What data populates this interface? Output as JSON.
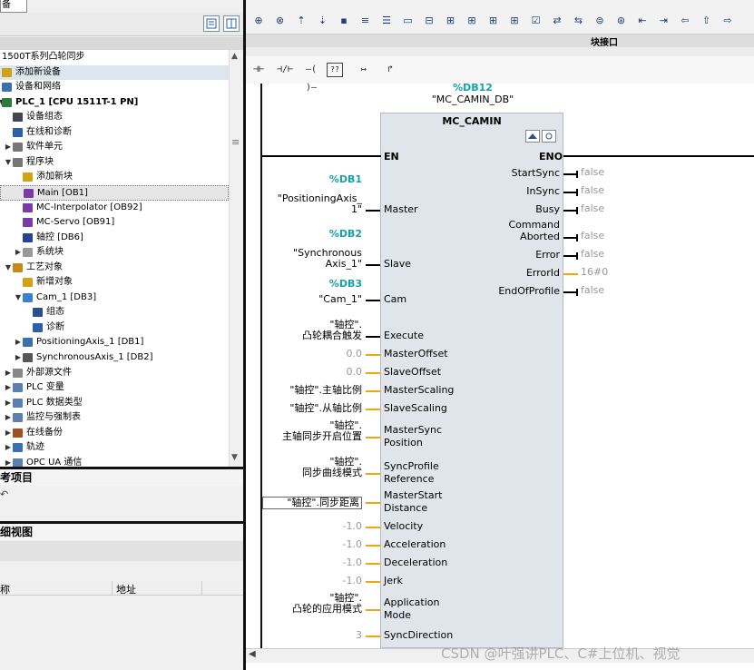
{
  "left_panel": {
    "tab_label": "备",
    "tree": [
      {
        "label": "1500T系列凸轮同步",
        "indent": 0,
        "icon": "none",
        "expander": "none"
      },
      {
        "label": "添加新设备",
        "indent": 0,
        "icon": "add-device-icon",
        "expander": "none",
        "highlight": true
      },
      {
        "label": "设备和网络",
        "indent": 0,
        "icon": "network-icon",
        "expander": "none"
      },
      {
        "label": "PLC_1 [CPU 1511T-1 PN]",
        "indent": 0,
        "icon": "plc-icon",
        "expander": "open",
        "bold": true
      },
      {
        "label": "设备组态",
        "indent": 1,
        "icon": "device-config-icon",
        "expander": "none"
      },
      {
        "label": "在线和诊断",
        "indent": 1,
        "icon": "diagnostics-icon",
        "expander": "none"
      },
      {
        "label": "软件单元",
        "indent": 1,
        "icon": "software-unit-icon",
        "expander": "closed"
      },
      {
        "label": "程序块",
        "indent": 1,
        "icon": "program-blocks-icon",
        "expander": "open"
      },
      {
        "label": "添加新块",
        "indent": 2,
        "icon": "add-block-icon",
        "expander": "none"
      },
      {
        "label": "Main [OB1]",
        "indent": 2,
        "icon": "ob-icon",
        "expander": "none",
        "selected": true
      },
      {
        "label": "MC-Interpolator [OB92]",
        "indent": 2,
        "icon": "ob-icon",
        "expander": "none"
      },
      {
        "label": "MC-Servo [OB91]",
        "indent": 2,
        "icon": "ob-icon",
        "expander": "none"
      },
      {
        "label": "轴控 [DB6]",
        "indent": 2,
        "icon": "db-icon",
        "expander": "none"
      },
      {
        "label": "系统块",
        "indent": 2,
        "icon": "system-blocks-icon",
        "expander": "closed"
      },
      {
        "label": "工艺对象",
        "indent": 1,
        "icon": "technology-objects-icon",
        "expander": "open"
      },
      {
        "label": "新增对象",
        "indent": 2,
        "icon": "add-object-icon",
        "expander": "none"
      },
      {
        "label": "Cam_1 [DB3]",
        "indent": 2,
        "icon": "cam-icon",
        "expander": "open"
      },
      {
        "label": "组态",
        "indent": 3,
        "icon": "configuration-icon",
        "expander": "none"
      },
      {
        "label": "诊断",
        "indent": 3,
        "icon": "diagnostics-icon",
        "expander": "none"
      },
      {
        "label": "PositioningAxis_1 [DB1]",
        "indent": 2,
        "icon": "positioning-axis-icon",
        "expander": "closed"
      },
      {
        "label": "SynchronousAxis_1 [DB2]",
        "indent": 2,
        "icon": "synchronous-axis-icon",
        "expander": "closed"
      },
      {
        "label": "外部源文件",
        "indent": 1,
        "icon": "external-source-icon",
        "expander": "closed"
      },
      {
        "label": "PLC 变量",
        "indent": 1,
        "icon": "plc-tags-icon",
        "expander": "closed"
      },
      {
        "label": "PLC 数据类型",
        "indent": 1,
        "icon": "plc-datatype-icon",
        "expander": "closed"
      },
      {
        "label": "监控与强制表",
        "indent": 1,
        "icon": "watch-table-icon",
        "expander": "closed"
      },
      {
        "label": "在线备份",
        "indent": 1,
        "icon": "online-backup-icon",
        "expander": "closed"
      },
      {
        "label": "轨迹",
        "indent": 1,
        "icon": "traces-icon",
        "expander": "closed"
      },
      {
        "label": "OPC UA 通信",
        "indent": 1,
        "icon": "opcua-icon",
        "expander": "closed"
      }
    ],
    "reference_title": "考项目",
    "detail_title": "细视图",
    "detail_columns": [
      "称",
      "地址"
    ]
  },
  "right_panel": {
    "interface_band": "块接口",
    "ladder_buttons": [
      "⊣⊢",
      "⊣/⊢",
      "–( )–",
      "??",
      "↦",
      "↱"
    ],
    "instance_db_number": "%DB12",
    "instance_db_name": "\"MC_CAMIN_DB\"",
    "fb_title": "MC_CAMIN",
    "en": "EN",
    "eno": "ENO",
    "inputs": [
      {
        "pin": "Master",
        "db": "%DB1",
        "param": "\"PositioningAxis_\n1\"",
        "wire": "black",
        "grey": false
      },
      {
        "pin": "Slave",
        "db": "%DB2",
        "param": "\"Synchronous\nAxis_1\"",
        "wire": "black",
        "grey": false
      },
      {
        "pin": "Cam",
        "db": "%DB3",
        "param": "\"Cam_1\"",
        "wire": "black",
        "grey": false
      },
      {
        "pin": "Execute",
        "db": "",
        "param": "\"轴控\".\n凸轮耦合触发",
        "wire": "black",
        "grey": false
      },
      {
        "pin": "MasterOffset",
        "db": "",
        "param": "0.0",
        "wire": "orange",
        "grey": true
      },
      {
        "pin": "SlaveOffset",
        "db": "",
        "param": "0.0",
        "wire": "orange",
        "grey": true
      },
      {
        "pin": "MasterScaling",
        "db": "",
        "param": "\"轴控\".主轴比例",
        "wire": "orange",
        "grey": false
      },
      {
        "pin": "SlaveScaling",
        "db": "",
        "param": "\"轴控\".从轴比例",
        "wire": "orange",
        "grey": false
      },
      {
        "pin": "MasterSync\nPosition",
        "db": "",
        "param": "\"轴控\".\n主轴同步开启位置",
        "wire": "orange",
        "grey": false
      },
      {
        "pin": "SyncProfile\nReference",
        "db": "",
        "param": "\"轴控\".\n同步曲线模式",
        "wire": "orange",
        "grey": false
      },
      {
        "pin": "MasterStart\nDistance",
        "db": "",
        "param": "\"轴控\".同步距离",
        "wire": "orange",
        "grey": false,
        "boxed": true
      },
      {
        "pin": "Velocity",
        "db": "",
        "param": "-1.0",
        "wire": "orange",
        "grey": true
      },
      {
        "pin": "Acceleration",
        "db": "",
        "param": "-1.0",
        "wire": "orange",
        "grey": true
      },
      {
        "pin": "Deceleration",
        "db": "",
        "param": "-1.0",
        "wire": "orange",
        "grey": true
      },
      {
        "pin": "Jerk",
        "db": "",
        "param": "-1.0",
        "wire": "orange",
        "grey": true
      },
      {
        "pin": "Application\nMode",
        "db": "",
        "param": "\"轴控\".\n凸轮的应用模式",
        "wire": "orange",
        "grey": false
      },
      {
        "pin": "SyncDirection",
        "db": "",
        "param": "3",
        "wire": "orange",
        "grey": true
      }
    ],
    "outputs": [
      {
        "pin": "StartSync",
        "value": "false",
        "wire": "black"
      },
      {
        "pin": "InSync",
        "value": "false",
        "wire": "black"
      },
      {
        "pin": "Busy",
        "value": "false",
        "wire": "black"
      },
      {
        "pin": "Command\nAborted",
        "value": "false",
        "wire": "black"
      },
      {
        "pin": "Error",
        "value": "false",
        "wire": "black"
      },
      {
        "pin": "ErrorId",
        "value": "16#0",
        "wire": "orange"
      },
      {
        "pin": "EndOfProfile",
        "value": "false",
        "wire": "black"
      }
    ],
    "watermark": "CSDN @叶强讲PLC、C#上位机、视觉"
  }
}
